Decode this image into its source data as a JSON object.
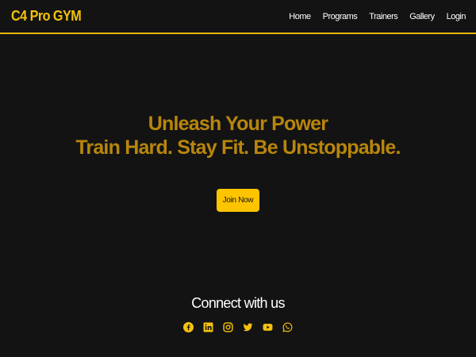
{
  "brand": {
    "name": "C4 Pro GYM"
  },
  "nav": {
    "items": [
      {
        "label": "Home"
      },
      {
        "label": "Programs"
      },
      {
        "label": "Trainers"
      },
      {
        "label": "Gallery"
      },
      {
        "label": "Login"
      }
    ]
  },
  "hero": {
    "headline": "Unleash Your Power",
    "tagline": "Train Hard. Stay Fit. Be Unstoppable.",
    "cta_label": "Join Now"
  },
  "footer": {
    "connect_title": "Connect with us",
    "socials": [
      {
        "icon": "facebook-icon"
      },
      {
        "icon": "linkedin-icon"
      },
      {
        "icon": "instagram-icon"
      },
      {
        "icon": "twitter-icon"
      },
      {
        "icon": "youtube-icon"
      },
      {
        "icon": "whatsapp-icon"
      }
    ]
  },
  "colors": {
    "background": "#131313",
    "brand_yellow": "#f4c20d",
    "headline_gold": "#b8860b",
    "button_yellow": "#ffc400",
    "nav_text": "#ffffff"
  }
}
